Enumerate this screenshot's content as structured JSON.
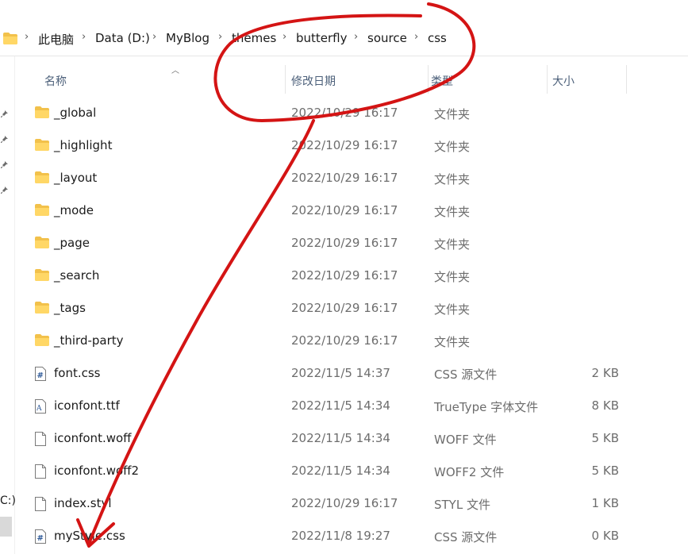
{
  "breadcrumb": {
    "items": [
      "此电脑",
      "Data (D:)",
      "MyBlog",
      "themes",
      "butterfly",
      "source",
      "css"
    ],
    "separator": "›"
  },
  "nav": {
    "drive_fragment": "C:)",
    "pins": [
      "pin-icon",
      "pin-icon",
      "pin-icon",
      "pin-icon"
    ]
  },
  "columns": {
    "name": "名称",
    "modified": "修改日期",
    "type": "类型",
    "size": "大小"
  },
  "files": [
    {
      "name": "_global",
      "modified": "2022/10/29 16:17",
      "type": "文件夹",
      "size": "",
      "icon": "folder-icon"
    },
    {
      "name": "_highlight",
      "modified": "2022/10/29 16:17",
      "type": "文件夹",
      "size": "",
      "icon": "folder-icon"
    },
    {
      "name": "_layout",
      "modified": "2022/10/29 16:17",
      "type": "文件夹",
      "size": "",
      "icon": "folder-icon"
    },
    {
      "name": "_mode",
      "modified": "2022/10/29 16:17",
      "type": "文件夹",
      "size": "",
      "icon": "folder-icon"
    },
    {
      "name": "_page",
      "modified": "2022/10/29 16:17",
      "type": "文件夹",
      "size": "",
      "icon": "folder-icon"
    },
    {
      "name": "_search",
      "modified": "2022/10/29 16:17",
      "type": "文件夹",
      "size": "",
      "icon": "folder-icon"
    },
    {
      "name": "_tags",
      "modified": "2022/10/29 16:17",
      "type": "文件夹",
      "size": "",
      "icon": "folder-icon"
    },
    {
      "name": "_third-party",
      "modified": "2022/10/29 16:17",
      "type": "文件夹",
      "size": "",
      "icon": "folder-icon"
    },
    {
      "name": "font.css",
      "modified": "2022/11/5 14:37",
      "type": "CSS 源文件",
      "size": "2 KB",
      "icon": "css-file-icon"
    },
    {
      "name": "iconfont.ttf",
      "modified": "2022/11/5 14:34",
      "type": "TrueType 字体文件",
      "size": "8 KB",
      "icon": "font-file-icon"
    },
    {
      "name": "iconfont.woff",
      "modified": "2022/11/5 14:34",
      "type": "WOFF 文件",
      "size": "5 KB",
      "icon": "file-icon"
    },
    {
      "name": "iconfont.woff2",
      "modified": "2022/11/5 14:34",
      "type": "WOFF2 文件",
      "size": "5 KB",
      "icon": "file-icon"
    },
    {
      "name": "index.styl",
      "modified": "2022/10/29 16:17",
      "type": "STYL 文件",
      "size": "1 KB",
      "icon": "file-icon"
    },
    {
      "name": "myStyle.css",
      "modified": "2022/11/8 19:27",
      "type": "CSS 源文件",
      "size": "0 KB",
      "icon": "css-file-icon"
    }
  ],
  "colors": {
    "annotation": "#d41414",
    "folder": "#f2c14b",
    "header_text": "#4c607a"
  }
}
